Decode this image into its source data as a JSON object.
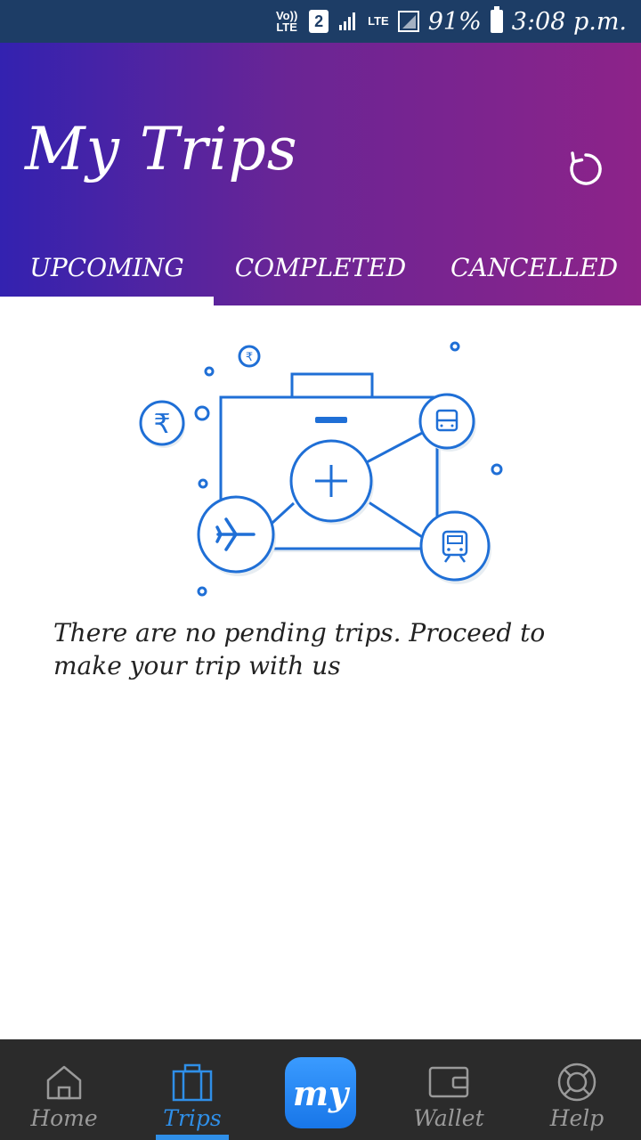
{
  "status_bar": {
    "volte": "Vo)) LTE",
    "sim_slot": "2",
    "network": "LTE",
    "battery": "91%",
    "time": "3:08 p.m."
  },
  "header": {
    "title": "My Trips",
    "refresh_icon": "refresh-icon"
  },
  "tabs": [
    {
      "label": "UPCOMING",
      "active": true
    },
    {
      "label": "COMPLETED",
      "active": false
    },
    {
      "label": "CANCELLED",
      "active": false
    }
  ],
  "empty_state": {
    "message": "There are no pending trips. Proceed to make your trip with us",
    "illustration_icons": [
      "suitcase-icon",
      "plus-icon",
      "rupee-icon",
      "bus-icon",
      "flight-icon",
      "train-icon"
    ]
  },
  "bottom_nav": {
    "items": [
      {
        "label": "Home",
        "icon": "home-icon",
        "active": false
      },
      {
        "label": "Trips",
        "icon": "suitcase-icon",
        "active": true
      },
      {
        "label": "my",
        "icon": "logo",
        "active": false
      },
      {
        "label": "Wallet",
        "icon": "wallet-icon",
        "active": false
      },
      {
        "label": "Help",
        "icon": "lifebuoy-icon",
        "active": false
      }
    ]
  },
  "colors": {
    "status_bar": "#1d3d66",
    "header_start": "#3322b0",
    "header_end": "#8d2389",
    "accent": "#2f8fe8",
    "illustration": "#1f6fd6",
    "nav_bg": "#2b2b2b"
  }
}
